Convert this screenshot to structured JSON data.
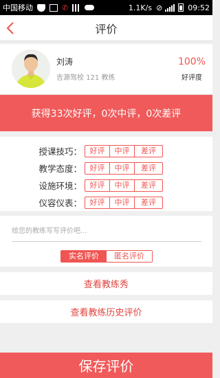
{
  "status_bar": {
    "carrier": "中国移动",
    "speed": "1.1K/s",
    "time": "09:52"
  },
  "header": {
    "title": "评价"
  },
  "coach": {
    "name": "刘涛",
    "school": "吉源驾校 121 教练",
    "rate_value": "100%",
    "rate_label": "好评度"
  },
  "summary": {
    "text": "获得33次好评，0次中评，0次差评"
  },
  "rating_options": {
    "good": "好评",
    "medium": "中评",
    "bad": "差评"
  },
  "ratings": [
    {
      "label": "授课技巧："
    },
    {
      "label": "教学态度："
    },
    {
      "label": "设施环境："
    },
    {
      "label": "仪容仪表："
    }
  ],
  "comment": {
    "placeholder": "给您的教练写写评价吧...",
    "value": ""
  },
  "identity_toggle": {
    "real_name": "实名评价",
    "anonymous": "匿名评价",
    "selected": "real_name"
  },
  "links": {
    "view_show": "查看教练秀",
    "view_history": "查看教练历史评价"
  },
  "save_button": "保存评价",
  "colors": {
    "accent": "#f05a5a",
    "accent_text": "#ef5552",
    "background": "#efefef"
  }
}
